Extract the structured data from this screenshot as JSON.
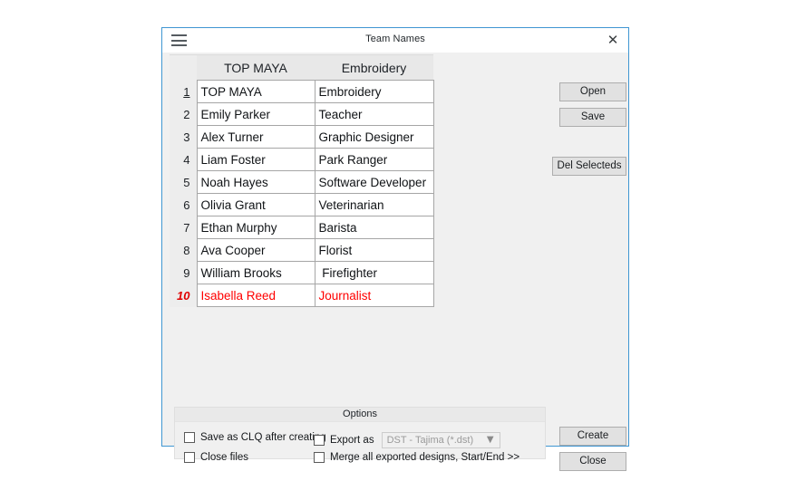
{
  "window": {
    "title": "Team Names",
    "menu_icon": "hamburger-icon",
    "close_icon": "close-icon",
    "accent_color": "#3f96d2"
  },
  "grid": {
    "columns": [
      "",
      "TOP MAYA",
      "Embroidery"
    ],
    "rows": [
      {
        "num": "1",
        "name": "TOP MAYA",
        "role": "Embroidery",
        "current": true,
        "flagged": false
      },
      {
        "num": "2",
        "name": "Emily Parker",
        "role": "Teacher",
        "current": false,
        "flagged": false
      },
      {
        "num": "3",
        "name": "Alex Turner",
        "role": "Graphic Designer",
        "current": false,
        "flagged": false
      },
      {
        "num": "4",
        "name": "Liam Foster",
        "role": "Park Ranger",
        "current": false,
        "flagged": false
      },
      {
        "num": "5",
        "name": "Noah Hayes",
        "role": "Software Developer",
        "current": false,
        "flagged": false
      },
      {
        "num": "6",
        "name": "Olivia Grant",
        "role": "Veterinarian",
        "current": false,
        "flagged": false
      },
      {
        "num": "7",
        "name": "Ethan Murphy",
        "role": "Barista",
        "current": false,
        "flagged": false
      },
      {
        "num": "8",
        "name": "Ava Cooper",
        "role": "Florist",
        "current": false,
        "flagged": false
      },
      {
        "num": "9",
        "name": "William Brooks",
        "role": " Firefighter",
        "current": false,
        "flagged": false
      },
      {
        "num": "10",
        "name": "Isabella Reed",
        "role": "Journalist",
        "current": false,
        "flagged": true
      }
    ],
    "flagged_color": "#ff0000"
  },
  "buttons": {
    "open": "Open",
    "save": "Save",
    "del_selecteds": "Del Selecteds",
    "create": "Create",
    "close": "Close"
  },
  "options": {
    "header": "Options",
    "save_as_clq": {
      "label": "Save as CLQ after creating",
      "checked": false
    },
    "close_files": {
      "label": "Close files",
      "checked": false
    },
    "export_as": {
      "label": "Export as",
      "checked": false
    },
    "merge_all": {
      "label": "Merge all exported designs, Start/End >>",
      "checked": false
    },
    "format_select": {
      "value": "DST - Tajima (*.dst)",
      "disabled": true,
      "chevron": "⌄",
      "options": [
        "DST - Tajima (*.dst)"
      ]
    }
  }
}
